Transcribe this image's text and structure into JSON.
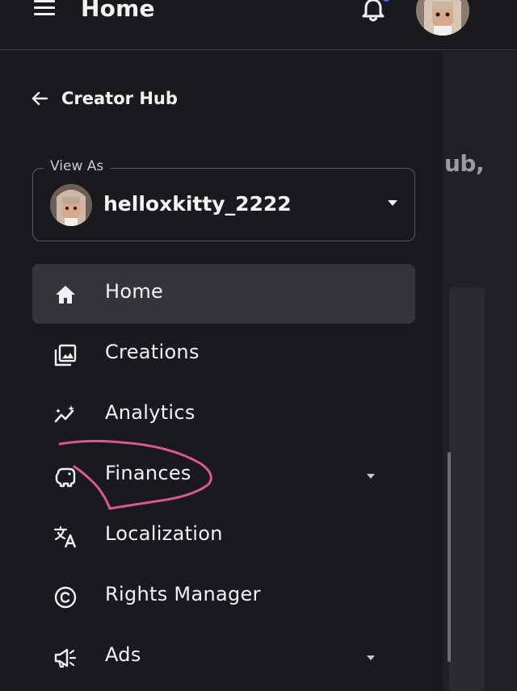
{
  "header": {
    "title": "Home",
    "menu_icon": "hamburger-menu-icon",
    "notification_icon": "bell-icon",
    "notification_dot_color": "#3b6cff",
    "avatar": "user-avatar"
  },
  "drawer": {
    "back_label": "Creator Hub",
    "back_icon": "arrow-left-icon",
    "view_as": {
      "legend": "View As",
      "selected_user": "helloxkitty_2222",
      "dropdown_icon": "caret-down-icon"
    },
    "nav": [
      {
        "label": "Home",
        "icon": "home-icon",
        "active": true,
        "has_submenu": false
      },
      {
        "label": "Creations",
        "icon": "image-gallery-icon",
        "active": false,
        "has_submenu": false
      },
      {
        "label": "Analytics",
        "icon": "analytics-sparkle-icon",
        "active": false,
        "has_submenu": false
      },
      {
        "label": "Finances",
        "icon": "piggy-bank-icon",
        "active": false,
        "has_submenu": true
      },
      {
        "label": "Localization",
        "icon": "translate-icon",
        "active": false,
        "has_submenu": false
      },
      {
        "label": "Rights Manager",
        "icon": "copyright-icon",
        "active": false,
        "has_submenu": false
      },
      {
        "label": "Ads",
        "icon": "megaphone-icon",
        "active": false,
        "has_submenu": true
      }
    ]
  },
  "background_page": {
    "partial_text": "ub,"
  },
  "annotation": {
    "color": "#e0559a",
    "target": "Finances"
  },
  "colors": {
    "background": "#191a1d",
    "active_item": "#34353a",
    "text": "#f2f2f3"
  }
}
